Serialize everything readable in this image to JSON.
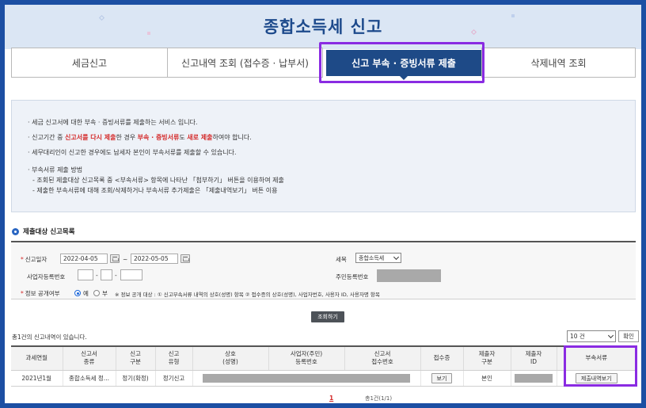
{
  "title": "종합소득세 신고",
  "tabs": [
    {
      "label": "세금신고",
      "active": false
    },
    {
      "label": "신고내역 조회 (접수증 · 납부서)",
      "active": false
    },
    {
      "label": "신고 부속 · 증빙서류 제출",
      "active": true
    },
    {
      "label": "삭제내역 조회",
      "active": false
    }
  ],
  "notice": {
    "line1": "· 세금 신고서에 대한 부속 · 증빙서류를 제출하는 서비스 입니다.",
    "line2": {
      "a": "· 신고기간 중 ",
      "b": "신고서를 다시 제출",
      "c": "한 경우 ",
      "d": "부속 · 증빙서류",
      "e": "도 ",
      "f": "새로 제출",
      "g": "하여야 합니다."
    },
    "line3": "· 세무대리인이 신고한 경우에도 납세자 본인이 부속서류를 제출할 수 있습니다.",
    "line4": "· 부속서류 제출 방법",
    "line5": "- 조회된 제출대상 신고목록 중 <부속서류> 항목에 나타난 「첨부하기」 버튼을 이용하여 제출",
    "line6": "- 제출한 부속서류에 대해 조회/삭제하거나 부속서류 추가제출은 「제출내역보기」 버튼 이용"
  },
  "list_title": "제출대상 신고목록",
  "search": {
    "date_label": "신고일자",
    "date_from": "2022-04-05",
    "date_sep": "~",
    "date_to": "2022-05-05",
    "tax_label": "세목",
    "tax_value": "종합소득세",
    "bizno_label": "사업자등록번호",
    "bizno_sep": "-",
    "resno_label": "주민등록번호",
    "public_label": "정보 공개여부",
    "public_yes": "예",
    "public_no": "부",
    "public_note": "※ 정보 공개 대상 : ① 신고부속서류 내역의 상호(성명) 항목 ② 접수증의 상호(성명), 사업자번호, 사용자 ID, 사용자명 항목",
    "button": "조회하기"
  },
  "results": {
    "count_text": "총1건의 신고내역이 있습니다.",
    "page_size": "10 건",
    "confirm": "확인",
    "headers": [
      "과세연월",
      "신고서\n종류",
      "신고\n구분",
      "신고\n유형",
      "상호\n(성명)",
      "사업자(주민)\n등록번호",
      "신고서\n접수번호",
      "접수증",
      "제출자\n구분",
      "제출자\nID",
      "부속서류"
    ],
    "rows": [
      {
        "period": "2021년1월",
        "form": "종합소득세 정...",
        "type": "정기(확정)",
        "kind": "정기신고",
        "receipt_btn": "보기",
        "submitter": "본인",
        "attach_btn": "제출내역보기"
      }
    ]
  },
  "pagination": {
    "current": "1",
    "info": "총1건(1/1)"
  }
}
